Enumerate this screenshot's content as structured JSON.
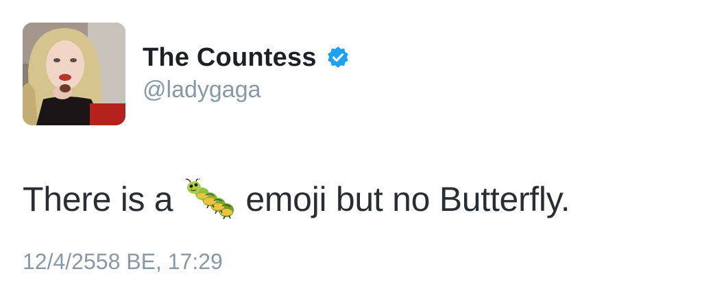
{
  "tweet": {
    "display_name": "The Countess",
    "handle": "@ladygaga",
    "verified": true,
    "text_before_emoji": "There is a",
    "emoji_icon": "caterpillar-icon",
    "text_after_emoji": "emoji but no Butterfly.",
    "timestamp": "12/4/2558 BE, 17:29"
  },
  "colors": {
    "name": "#1d2126",
    "handle": "#8899a6",
    "text": "#2a2d33",
    "verified": "#1da1f2"
  }
}
